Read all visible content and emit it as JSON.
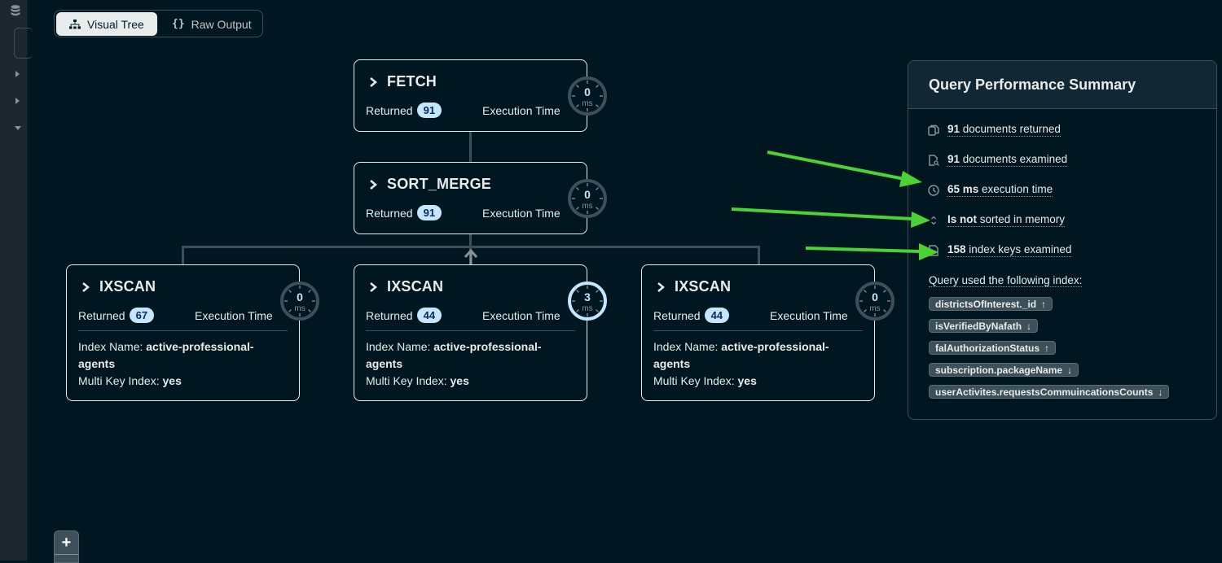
{
  "view_toggle": {
    "options": [
      {
        "label": "Visual Tree",
        "icon": "tree-icon",
        "selected": true
      },
      {
        "label": "Raw Output",
        "icon": "braces-icon",
        "selected": false
      }
    ],
    "braces_glyph": "{}"
  },
  "sidebar": {
    "icons": [
      "database-icon",
      "caret-right-icon",
      "caret-right-icon",
      "caret-down-icon"
    ]
  },
  "stages": [
    {
      "name": "FETCH",
      "returned_label": "Returned",
      "returned": "91",
      "exec_label": "Execution Time",
      "time": "0",
      "unit": "ms",
      "highlight": false
    },
    {
      "name": "SORT_MERGE",
      "returned_label": "Returned",
      "returned": "91",
      "exec_label": "Execution Time",
      "time": "0",
      "unit": "ms",
      "highlight": false
    },
    {
      "name": "IXSCAN",
      "returned_label": "Returned",
      "returned": "67",
      "exec_label": "Execution Time",
      "time": "0",
      "unit": "ms",
      "highlight": false,
      "index_name_label": "Index Name: ",
      "index_name": "active-professional-agents",
      "multikey_label": "Multi Key Index: ",
      "multikey": "yes"
    },
    {
      "name": "IXSCAN",
      "returned_label": "Returned",
      "returned": "44",
      "exec_label": "Execution Time",
      "time": "3",
      "unit": "ms",
      "highlight": true,
      "index_name_label": "Index Name: ",
      "index_name": "active-professional-agents",
      "multikey_label": "Multi Key Index: ",
      "multikey": "yes"
    },
    {
      "name": "IXSCAN",
      "returned_label": "Returned",
      "returned": "44",
      "exec_label": "Execution Time",
      "time": "0",
      "unit": "ms",
      "highlight": false,
      "index_name_label": "Index Name: ",
      "index_name": "active-professional-agents",
      "multikey_label": "Multi Key Index: ",
      "multikey": "yes"
    }
  ],
  "summary": {
    "title": "Query Performance Summary",
    "items": [
      {
        "icon": "copy-documents-icon",
        "bold": "91",
        "text": " documents returned"
      },
      {
        "icon": "document-search-icon",
        "bold": "91",
        "text": " documents examined"
      },
      {
        "icon": "clock-icon",
        "bold": "65 ms",
        "text": " execution time"
      },
      {
        "icon": "sort-chevrons-icon",
        "bold": "Is not",
        "text": " sorted in memory"
      },
      {
        "icon": "index-document-icon",
        "bold": "158",
        "text": " index keys examined"
      }
    ],
    "index_label": "Query used the following index:",
    "index_fields": [
      {
        "name": "districtsOfInterest._id",
        "direction": "↑"
      },
      {
        "name": "isVerifiedByNafath",
        "direction": "↓"
      },
      {
        "name": "falAuthorizationStatus",
        "direction": "↑"
      },
      {
        "name": "subscription.packageName",
        "direction": "↓"
      },
      {
        "name": "userActivites.requestsCommuincationsCounts",
        "direction": "↓"
      }
    ]
  },
  "zoom_controls": {
    "zoom_in_label": "+"
  },
  "colors": {
    "background": "#001620",
    "badge": "#c3e7fe",
    "clock_highlight": "#c3e7fe",
    "clock_normal": "#3d4f58",
    "annotation_arrow": "#4cd137"
  }
}
